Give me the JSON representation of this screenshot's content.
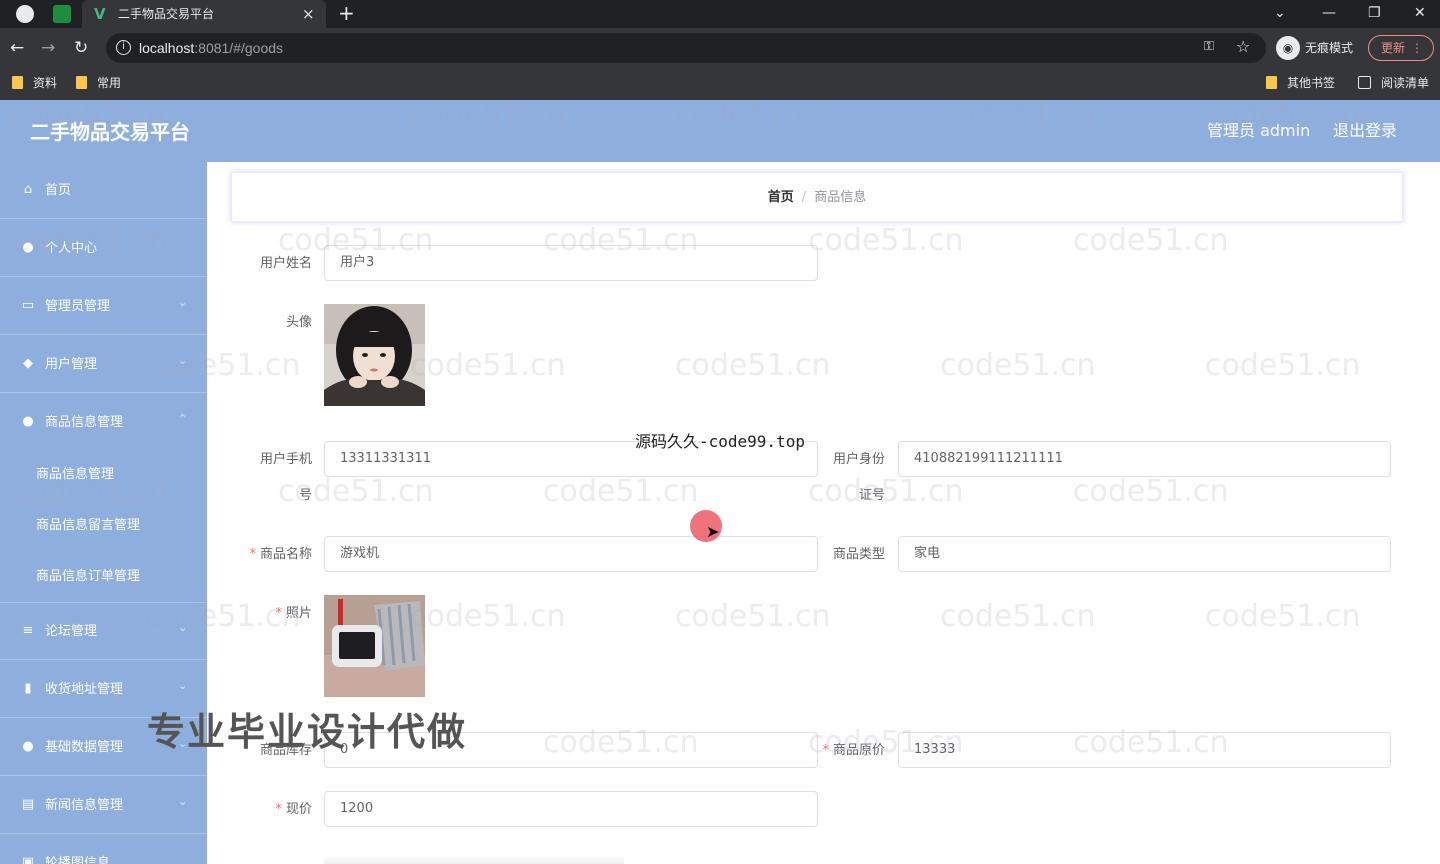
{
  "browser": {
    "tab_title": "二手物品交易平台",
    "tab_logo": "V",
    "url_host": "localhost",
    "url_rest": ":8081/#/goods",
    "incognito_label": "无痕模式",
    "update_label": "更新",
    "bookmarks": [
      "资料",
      "常用"
    ],
    "other_bookmarks": "其他书签",
    "reading_list": "阅读清单"
  },
  "header": {
    "title": "二手物品交易平台",
    "admin": "管理员 admin",
    "logout": "退出登录"
  },
  "sidebar": {
    "items": [
      {
        "label": "首页",
        "icon": "home-icon"
      },
      {
        "label": "个人中心",
        "icon": "user-icon"
      },
      {
        "label": "管理员管理",
        "icon": "doc-icon"
      },
      {
        "label": "用户管理",
        "icon": "group-icon"
      },
      {
        "label": "商品信息管理",
        "icon": "user-icon"
      },
      {
        "label": "论坛管理",
        "icon": "list-icon"
      },
      {
        "label": "收货地址管理",
        "icon": "chart-icon"
      },
      {
        "label": "基础数据管理",
        "icon": "user-icon"
      },
      {
        "label": "新闻信息管理",
        "icon": "news-icon"
      },
      {
        "label": "轮播图信息",
        "icon": "image-icon"
      }
    ],
    "sub_items": [
      "商品信息管理",
      "商品信息留言管理",
      "商品信息订单管理"
    ]
  },
  "breadcrumb": {
    "home": "首页",
    "current": "商品信息"
  },
  "form": {
    "username_label": "用户姓名",
    "username": "用户3",
    "avatar_label": "头像",
    "phone_label_1": "用户手机",
    "phone_label_2": "号",
    "phone": "13311331311",
    "idcard_label_1": "用户身份",
    "idcard_label_2": "证号",
    "idcard": "410882199111211111",
    "goods_name_label": "商品名称",
    "goods_name": "游戏机",
    "goods_type_label": "商品类型",
    "goods_type": "家电",
    "photo_label": "照片",
    "stock_label": "商品库存",
    "stock": "0",
    "original_price_label": "商品原价",
    "original_price": "13333",
    "price_label": "现价",
    "price": "1200"
  },
  "overlays": {
    "watermark": "code51.cn",
    "center_text": "源码久久-code99.top",
    "promo_text": "专业毕业设计代做"
  }
}
